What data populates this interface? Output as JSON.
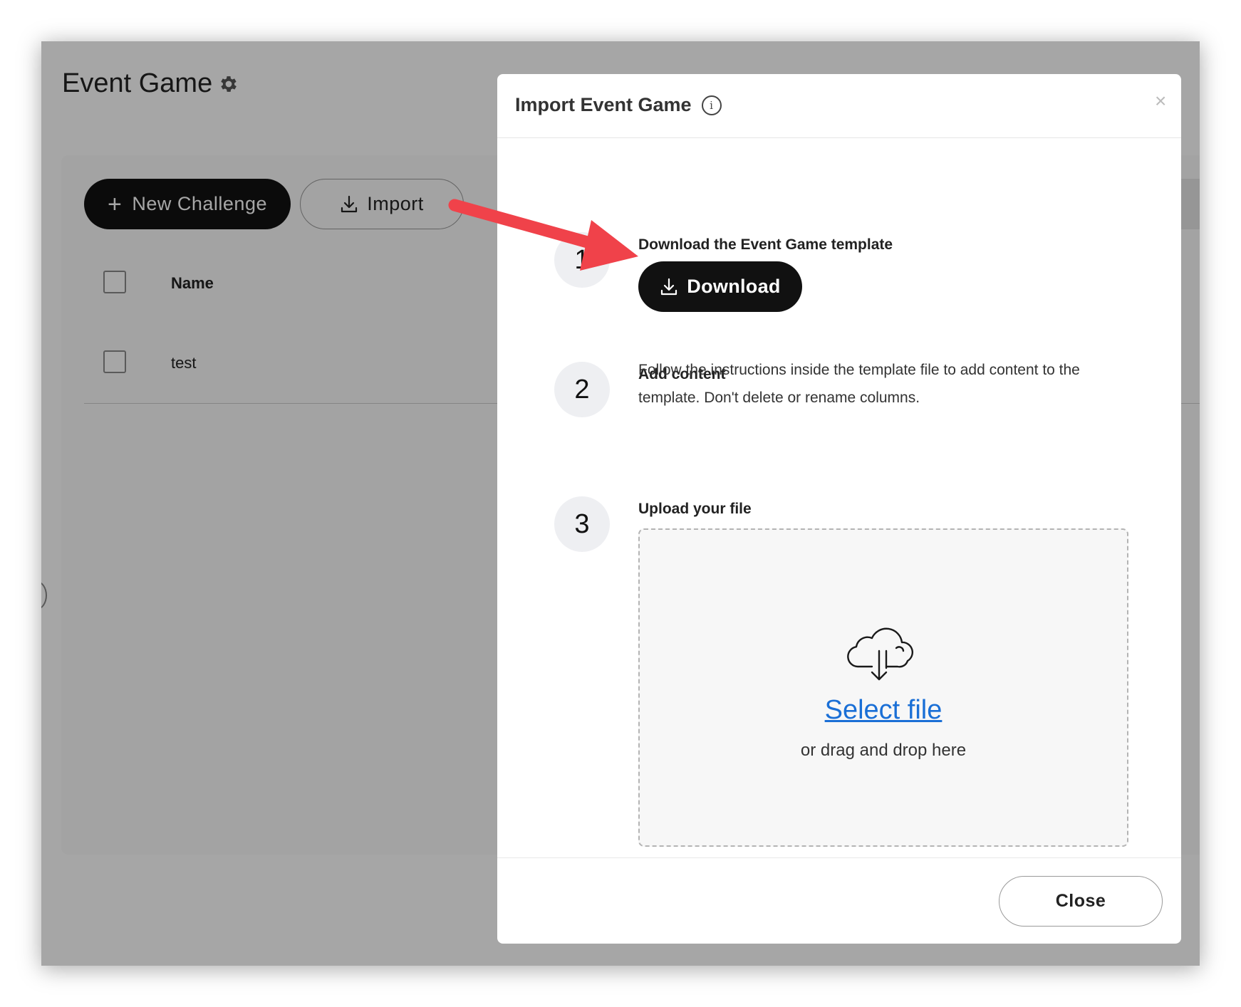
{
  "page": {
    "title": "Event Game",
    "new_challenge_label": "New Challenge",
    "import_label": "Import",
    "table": {
      "columns": [
        "Name"
      ],
      "rows": [
        {
          "name": "test"
        }
      ]
    }
  },
  "modal": {
    "title": "Import Event Game",
    "close_x": "×",
    "steps": [
      {
        "number": "1",
        "title": "Download the Event Game template",
        "button_label": "Download"
      },
      {
        "number": "2",
        "title": "Add content",
        "body": "Follow the instructions inside the template file to add content to the template. Don't delete or rename columns."
      },
      {
        "number": "3",
        "title": "Upload your file"
      }
    ],
    "dropzone": {
      "link_label": "Select file",
      "hint": "or drag and drop here",
      "icon": "cloud-download-icon"
    },
    "close_label": "Close"
  },
  "colors": {
    "primary_button": "#111111",
    "link": "#1a6fd6",
    "annotation_arrow": "#f0424a"
  }
}
